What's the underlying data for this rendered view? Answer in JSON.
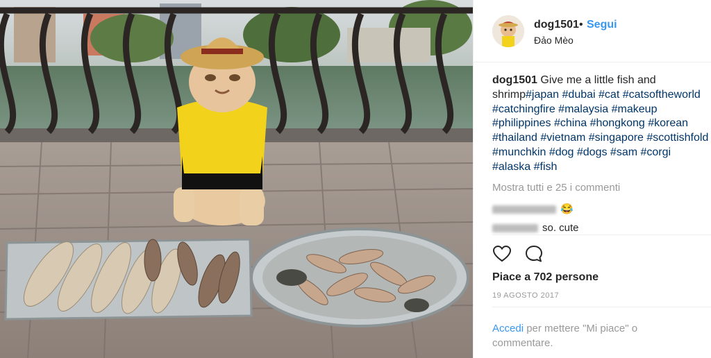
{
  "post": {
    "username": "dog1501",
    "separator": "•",
    "follow_label": "Segui",
    "location": "Đảo Mèo",
    "caption_text": "Give me a little fish and shrimp",
    "hashtags": [
      "#japan",
      "#dubai",
      "#cat",
      "#catsoftheworld",
      "#catchingfire",
      "#malaysia",
      "#makeup",
      "#philippines",
      "#china",
      "#hongkong",
      "#korean",
      "#thailand",
      "#vietnam",
      "#singapore",
      "#scottishfold",
      "#munchkin",
      "#dog",
      "#dogs",
      "#sam",
      "#corgi",
      "#alaska",
      "#fish"
    ],
    "view_all_comments": "Mostra tutti e 25 i commenti",
    "comments": [
      {
        "text": "😂",
        "author_hidden": true
      },
      {
        "text": "so. cute",
        "author_hidden": true
      }
    ],
    "likes_text": "Piace a 702 persone",
    "date": "19 AGOSTO 2017",
    "login_link": "Accedi",
    "login_rest": " per mettere \"Mi piace\" o commentare."
  },
  "icons": {
    "like": "heart-icon",
    "comment": "speech-bubble-icon"
  },
  "colors": {
    "link_blue": "#3897f0",
    "hashtag": "#003569",
    "muted": "#999999",
    "text": "#262626"
  }
}
